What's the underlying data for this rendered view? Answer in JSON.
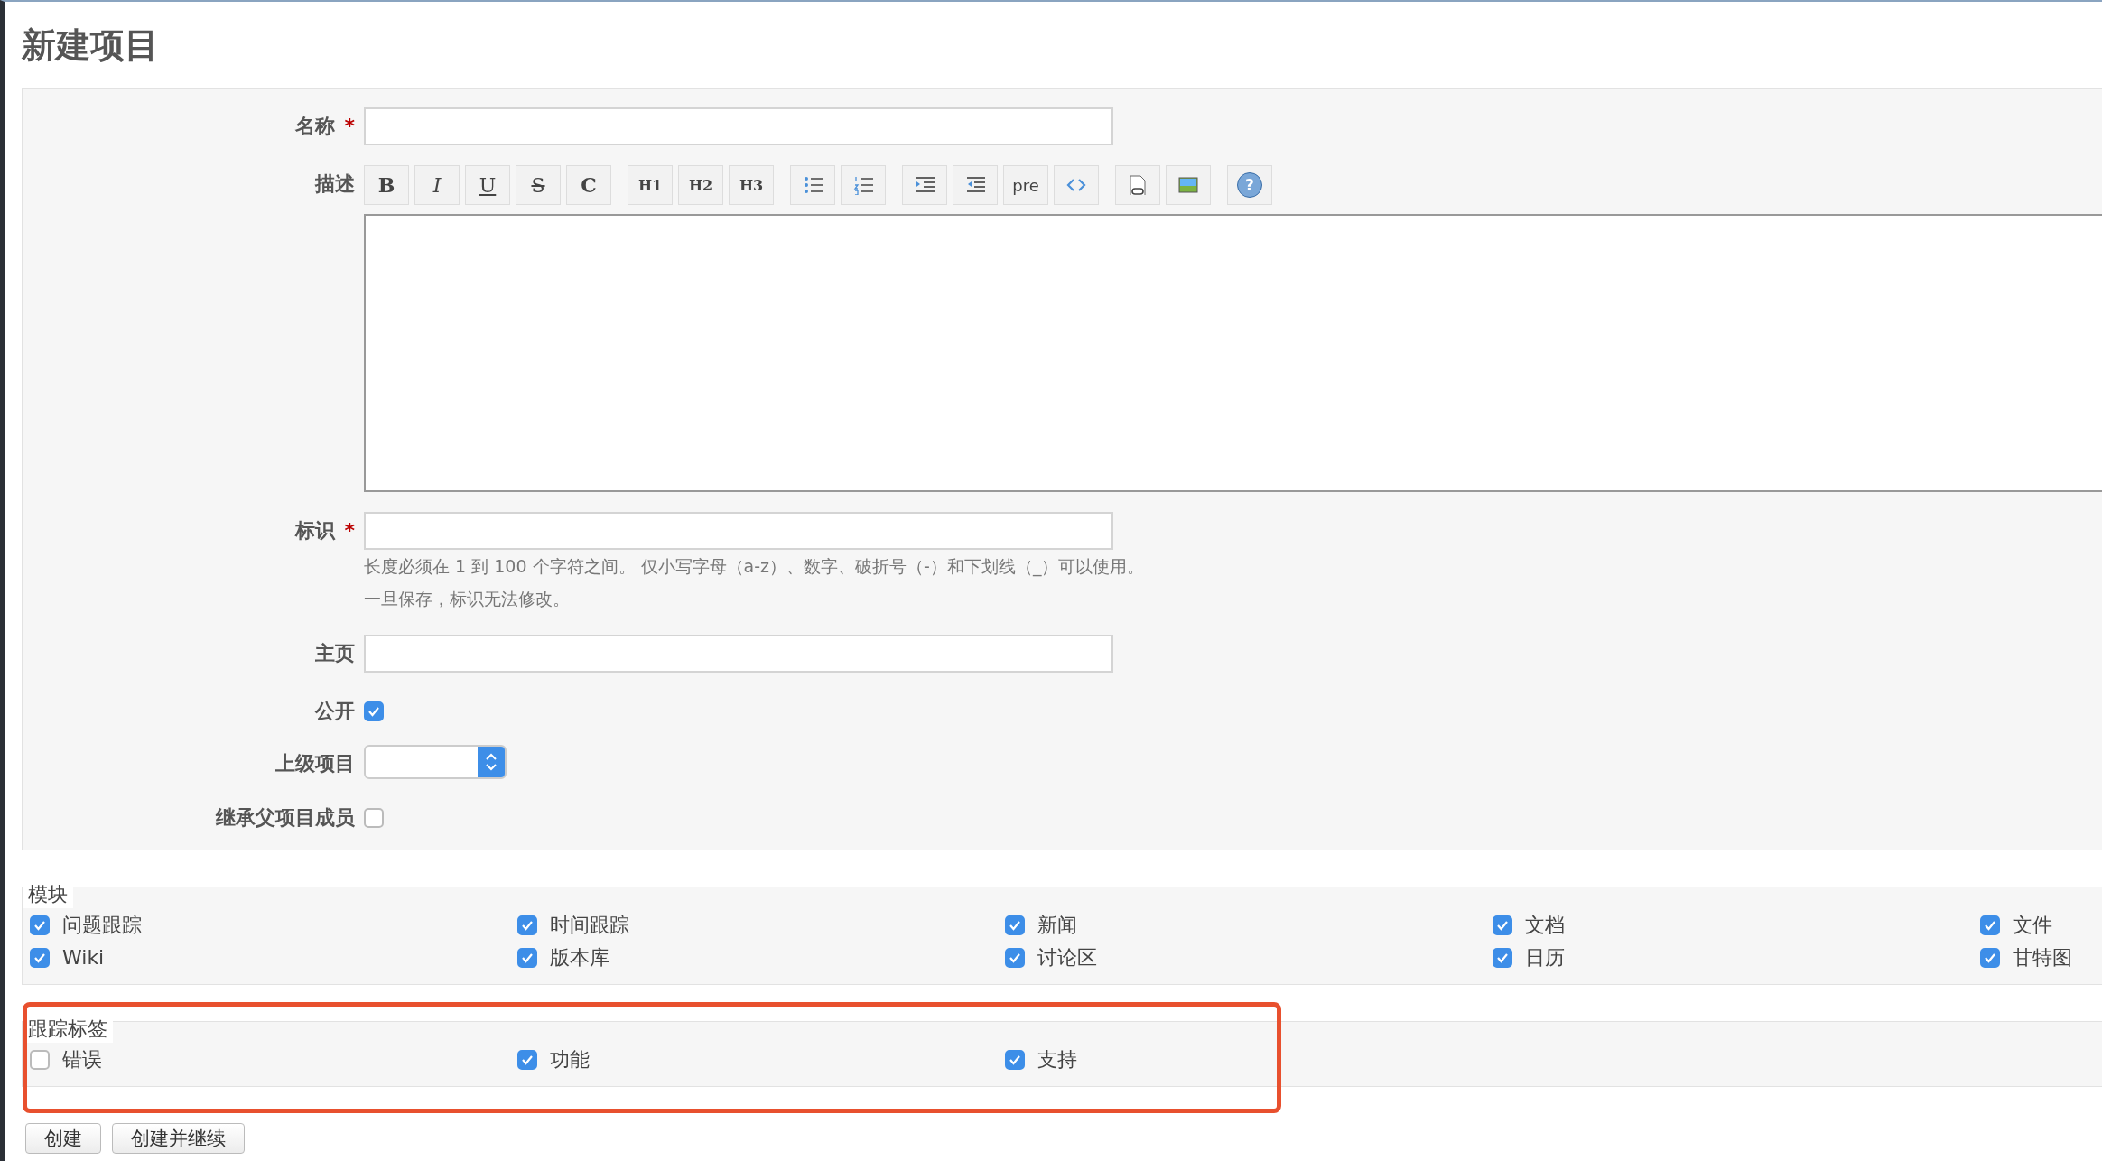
{
  "page_title": "新建项目",
  "form": {
    "name": {
      "label": "名称",
      "required_mark": "*"
    },
    "description": {
      "label": "描述",
      "toolbar_groups": [
        [
          {
            "kind": "bold",
            "label": "B"
          },
          {
            "kind": "italic",
            "label": "I"
          },
          {
            "kind": "underline",
            "label": "U"
          },
          {
            "kind": "strike",
            "label": "S"
          },
          {
            "kind": "inline-code",
            "label": "C"
          }
        ],
        [
          {
            "kind": "heading",
            "label": "H1"
          },
          {
            "kind": "heading",
            "label": "H2"
          },
          {
            "kind": "heading",
            "label": "H3"
          }
        ],
        [
          {
            "kind": "ul"
          },
          {
            "kind": "ol"
          }
        ],
        [
          {
            "kind": "indent"
          },
          {
            "kind": "outdent"
          },
          {
            "kind": "pre",
            "label": "pre"
          },
          {
            "kind": "code"
          }
        ],
        [
          {
            "kind": "link"
          },
          {
            "kind": "image"
          }
        ],
        [
          {
            "kind": "help",
            "label": "?"
          }
        ]
      ]
    },
    "identifier": {
      "label": "标识",
      "required_mark": "*",
      "hints": [
        "长度必须在 1 到 100 个字符之间。 仅小写字母（a-z）、数字、破折号（-）和下划线（_）可以使用。",
        "一旦保存，标识无法修改。"
      ]
    },
    "homepage": {
      "label": "主页"
    },
    "public": {
      "label": "公开",
      "checked": true
    },
    "parent": {
      "label": "上级项目"
    },
    "inherit_members": {
      "label": "继承父项目成员",
      "checked": false
    }
  },
  "modules": {
    "legend": "模块",
    "items": [
      {
        "label": "问题跟踪",
        "checked": true
      },
      {
        "label": "时间跟踪",
        "checked": true
      },
      {
        "label": "新闻",
        "checked": true
      },
      {
        "label": "文档",
        "checked": true
      },
      {
        "label": "文件",
        "checked": true
      },
      {
        "label": "Wiki",
        "checked": true
      },
      {
        "label": "版本库",
        "checked": true
      },
      {
        "label": "讨论区",
        "checked": true
      },
      {
        "label": "日历",
        "checked": true
      },
      {
        "label": "甘特图",
        "checked": true
      }
    ]
  },
  "trackers": {
    "legend": "跟踪标签",
    "highlighted": true,
    "items": [
      {
        "label": "错误",
        "checked": false
      },
      {
        "label": "功能",
        "checked": true
      },
      {
        "label": "支持",
        "checked": true
      }
    ]
  },
  "buttons": [
    "创建",
    "创建并继续"
  ]
}
